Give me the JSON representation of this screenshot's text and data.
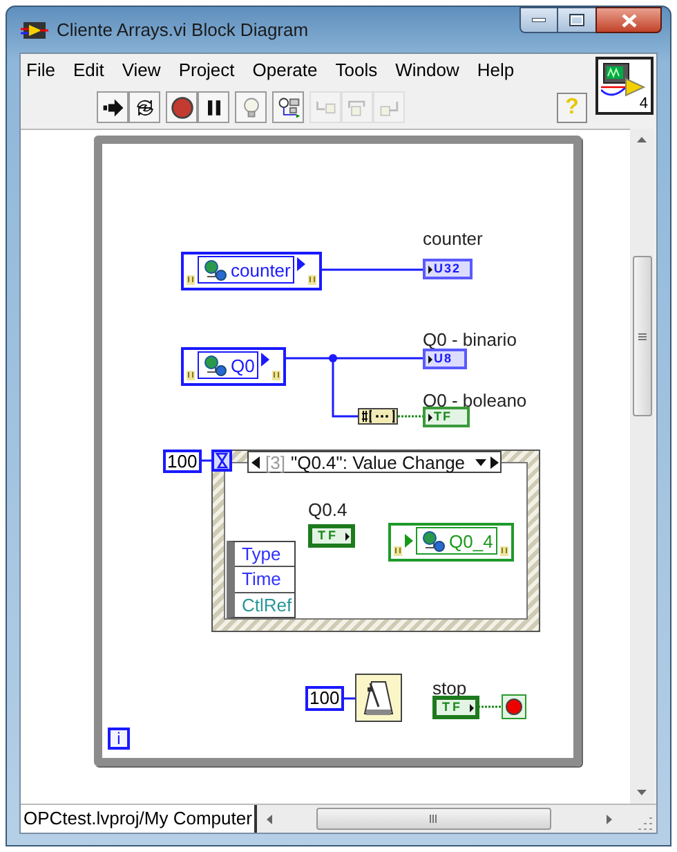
{
  "window": {
    "title": "Cliente Arrays.vi Block Diagram"
  },
  "menu": [
    "File",
    "Edit",
    "View",
    "Project",
    "Operate",
    "Tools",
    "Window",
    "Help"
  ],
  "toolbar": [
    {
      "kind": "run",
      "disabled": false
    },
    {
      "kind": "run-continuous",
      "disabled": false
    },
    {
      "kind": "abort",
      "disabled": false
    },
    {
      "kind": "pause",
      "disabled": false
    },
    {
      "kind": "highlight",
      "disabled": false
    },
    {
      "kind": "retain",
      "disabled": false
    },
    {
      "kind": "step-into",
      "disabled": true
    },
    {
      "kind": "step-over",
      "disabled": true
    },
    {
      "kind": "step-out",
      "disabled": true
    },
    {
      "kind": "help",
      "label": "?",
      "disabled": false
    }
  ],
  "icon_pane": {
    "label": "4"
  },
  "diagram": {
    "loop_counter": "i",
    "variables": [
      {
        "name": "counter",
        "kind": "read"
      },
      {
        "name": "Q0",
        "kind": "read"
      },
      {
        "name": "Q0_4",
        "kind": "write"
      }
    ],
    "indicators": [
      {
        "label": "counter",
        "type": "U32",
        "kind": "numeric"
      },
      {
        "label": "Q0 - binario",
        "type": "U8",
        "kind": "numeric"
      },
      {
        "label": "Q0 - boleano",
        "type": "TF",
        "kind": "boolean"
      }
    ],
    "timeout": "100",
    "event_case": {
      "case_index": "[3]",
      "case_name": "\"Q0.4\": Value Change",
      "data": [
        {
          "label": "Type",
          "color": "#3030ff"
        },
        {
          "label": "Time",
          "color": "#3030ff"
        },
        {
          "label": "CtlRef",
          "color": "#2a9696"
        }
      ]
    },
    "control": {
      "label": "Q0.4",
      "type": "TF"
    },
    "wait_ms": "100",
    "stop": {
      "label": "stop",
      "type": "TF"
    }
  },
  "status_bar": {
    "path": "OPCtest.lvproj/My Computer"
  }
}
